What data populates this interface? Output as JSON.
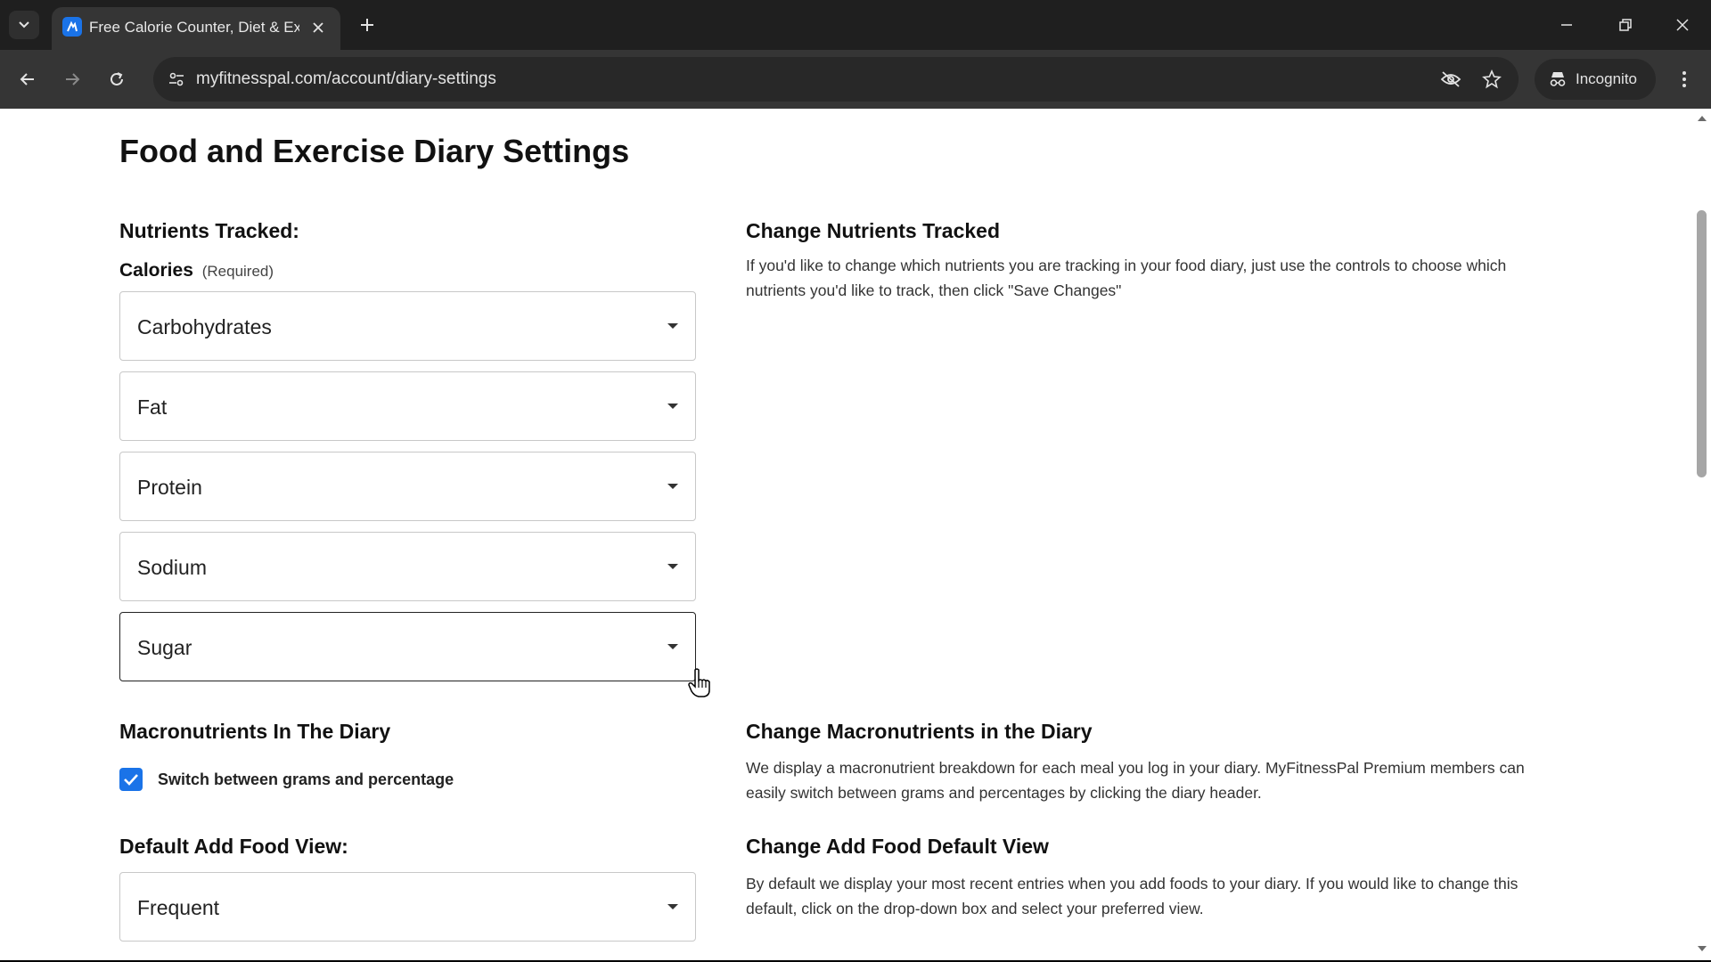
{
  "browser": {
    "tab": {
      "title": "Free Calorie Counter, Diet & Exercise Journal | MyFitnessPal.com",
      "favicon": "myfitnesspal-favicon"
    },
    "url": "myfitnesspal.com/account/diary-settings",
    "incognito_label": "Incognito"
  },
  "page": {
    "title": "Food and Exercise Diary Settings",
    "nutrients": {
      "heading": "Nutrients Tracked:",
      "calories_label": "Calories",
      "calories_required": "(Required)",
      "selects": [
        {
          "value": "Carbohydrates"
        },
        {
          "value": "Fat"
        },
        {
          "value": "Protein"
        },
        {
          "value": "Sodium"
        },
        {
          "value": "Sugar"
        }
      ],
      "help_heading": "Change Nutrients Tracked",
      "help_text": "If you'd like to change which nutrients you are tracking in your food diary, just use the controls to choose which nutrients you'd like to track, then click \"Save Changes\""
    },
    "macros": {
      "heading": "Macronutrients In The Diary",
      "checkbox_label": "Switch between grams and percentage",
      "checked": true,
      "help_heading": "Change Macronutrients in the Diary",
      "help_text": "We display a macronutrient breakdown for each meal you log in your diary. MyFitnessPal Premium members can easily switch between grams and percentages by clicking the diary header."
    },
    "add_food_view": {
      "heading": "Default Add Food View:",
      "value": "Frequent",
      "help_heading": "Change Add Food Default View",
      "help_text": "By default we display your most recent entries when you add foods to your diary. If you would like to change this default, click on the drop-down box and select your preferred view."
    }
  },
  "colors": {
    "accent": "#1a73e8",
    "chrome_dark": "#1f1f1f",
    "chrome_toolbar": "#353535"
  }
}
